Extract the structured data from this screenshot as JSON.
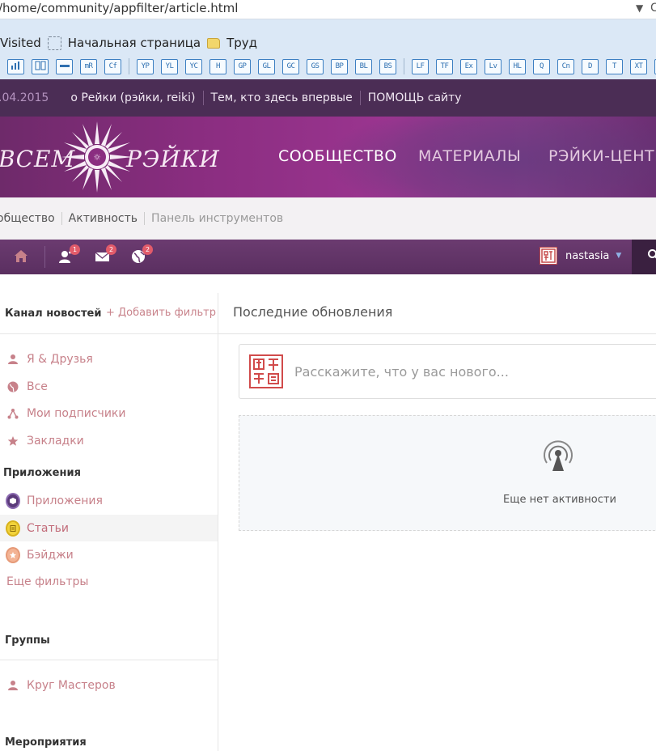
{
  "browser": {
    "url": "/home/community/appfilter/article.html",
    "bookmarks": [
      "Visited",
      "Начальная страница",
      "Труд"
    ],
    "toolbar_icons": [
      "uplot",
      "graph",
      "bar",
      "mR",
      "Cf",
      "YP",
      "YL",
      "YC",
      "H",
      "GP",
      "GL",
      "GC",
      "GS",
      "BP",
      "BL",
      "BS",
      "LF",
      "TF",
      "Ex",
      "Lv",
      "HL",
      "Q",
      "Cn",
      "D",
      "T",
      "XT",
      "C"
    ]
  },
  "topstrip": {
    "date": ".04.2015",
    "links": [
      "о Рейки (рэйки, reiki)",
      "Тем, кто здесь впервые",
      "ПОМОЩЬ сайту"
    ]
  },
  "header": {
    "logo_left": "ВСЕМ",
    "logo_right": "РЭЙКИ",
    "nav": [
      "СООБЩЕСТВО",
      "МАТЕРИАЛЫ",
      "РЭЙКИ-ЦЕНТР"
    ]
  },
  "breadcrumbs": [
    "общество",
    "Активность",
    "Панель инструментов"
  ],
  "toolbar": {
    "friends_badge": "1",
    "messages_badge": "2",
    "notifications_badge": "2",
    "username": "nastasia"
  },
  "sidebar": {
    "feed_title": "Канал новостей",
    "add_filter": "+ Добавить фильтр",
    "feed_items": [
      "Я & Друзья",
      "Все",
      "Мои подписчики",
      "Закладки"
    ],
    "apps_title": "Приложения",
    "app_items": [
      "Приложения",
      "Статьи",
      "Бэйджи"
    ],
    "more_filters": "Еще фильтры",
    "groups_title": "Группы",
    "group_items": [
      "Круг Мастеров"
    ],
    "events_title": "Мероприятия"
  },
  "main": {
    "title": "Последние обновления",
    "composer_placeholder": "Расскажите, что у вас нового...",
    "empty_text": "Еще нет активности"
  },
  "colors": {
    "site_purple": "#4b2d55",
    "link_pink": "#c7818a",
    "badge_red": "#e25b6a"
  }
}
